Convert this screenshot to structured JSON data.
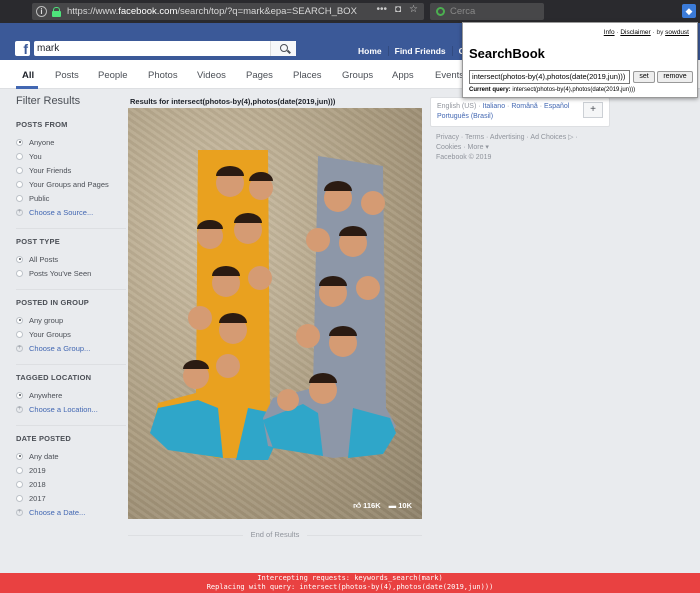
{
  "browser": {
    "url_prefix": "https://www.",
    "url_domain": "facebook.com",
    "url_path": "/search/top/?q=mark&epa=SEARCH_BOX",
    "menu_dots": "•••",
    "search_placeholder": "Cerca"
  },
  "fb": {
    "logo": "f",
    "search_value": "mark",
    "nav": [
      "Home",
      "Find Friends",
      "Crea"
    ]
  },
  "tabs": [
    "All",
    "Posts",
    "People",
    "Photos",
    "Videos",
    "Pages",
    "Places",
    "Groups",
    "Apps",
    "Events"
  ],
  "sidebar": {
    "title": "Filter Results",
    "sections": [
      {
        "title": "POSTS FROM",
        "options": [
          "Anyone",
          "You",
          "Your Friends",
          "Your Groups and Pages",
          "Public"
        ],
        "selected": 0,
        "link": "Choose a Source..."
      },
      {
        "title": "POST TYPE",
        "options": [
          "All Posts",
          "Posts You've Seen"
        ],
        "selected": 0
      },
      {
        "title": "POSTED IN GROUP",
        "options": [
          "Any group",
          "Your Groups"
        ],
        "selected": 0,
        "link": "Choose a Group..."
      },
      {
        "title": "TAGGED LOCATION",
        "options": [
          "Anywhere"
        ],
        "selected": 0,
        "link": "Choose a Location..."
      },
      {
        "title": "DATE POSTED",
        "options": [
          "Any date",
          "2019",
          "2018",
          "2017"
        ],
        "selected": 0,
        "link": "Choose a Date..."
      }
    ]
  },
  "results": {
    "title": "Results for intersect(photos-by(4),photos(date(2019,jun)))",
    "likes": "116K",
    "comments": "10K",
    "end": "End of Results"
  },
  "right": {
    "lang_current": "English (US) · ",
    "lang_links": [
      "Italiano",
      "Română",
      "Español",
      "Português (Brasil)"
    ],
    "lang_plus": "+",
    "footer_line1": "Privacy · Terms · Advertising · Ad Choices ▷ ·",
    "footer_line2": "Cookies · More ▾",
    "footer_line3": "Facebook © 2019"
  },
  "popup": {
    "info": "Info",
    "disclaimer": "Disclaimer",
    "by": " · by ",
    "author": "sowdust",
    "title": "SearchBook",
    "input_value": "intersect(photos-by(4),photos(date(2019,jun)))",
    "set_label": "set",
    "remove_label": "remove",
    "current_label": "Current query:",
    "current_value": " intersect(photos-by(4),photos(date(2019,jun)))"
  },
  "intercept": {
    "line1": "Intercepting requests: keywords_search(mark)",
    "line2": "Replacing with query: intersect(photos-by(4),photos(date(2019,jun)))"
  },
  "colors": {
    "fb_blue": "#3b5998",
    "link": "#4267b2",
    "intercept_red": "#e94141",
    "sock_orange": "#e9a11f",
    "sock_gray": "#8d97a8",
    "sock_teal": "#2fa6c9"
  }
}
